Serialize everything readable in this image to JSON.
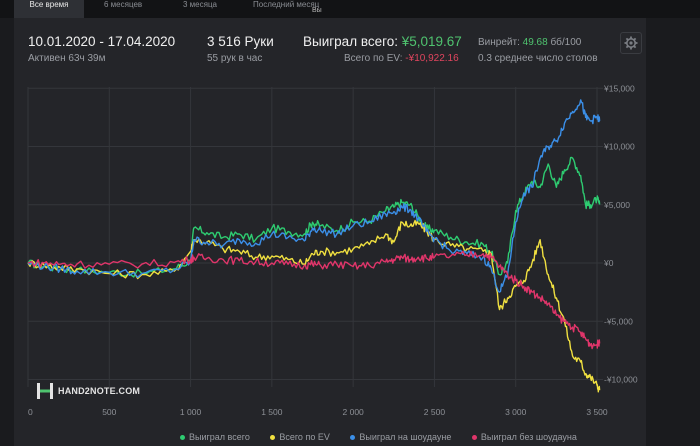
{
  "tabs": [
    {
      "label": "Все время",
      "active": true
    },
    {
      "label": "6 месяцев",
      "active": false
    },
    {
      "label": "3 месяца",
      "active": false
    },
    {
      "label": "Последний месяц",
      "active": false
    }
  ],
  "tab_extra": "Вы",
  "summary": {
    "date_range": "10.01.2020 - 17.04.2020",
    "active_time": "Активен 63ч 39м",
    "hands": "3 516 Руки",
    "hands_per_hour": "55 рук в час",
    "won_total_label": "Выиграл всего:",
    "won_total_value": "¥5,019.67",
    "ev_total_label": "Всего по EV:",
    "ev_total_value": "-¥10,922.16",
    "winrate_label": "Винрейт:",
    "winrate_value": "49.68",
    "winrate_unit": "бб/100",
    "tables_avg": "0.3 среднее число столов"
  },
  "logo_text": "HAND2NOTE.COM",
  "colors": {
    "won": "#2ecc71",
    "ev": "#f0e040",
    "showdown": "#3b8fe8",
    "no_showdown": "#e0356a",
    "accent_green": "#4fc36f",
    "accent_red": "#e0455e"
  },
  "chart_data": {
    "type": "line",
    "x_ticks": [
      "0",
      "500",
      "1 000",
      "1 500",
      "2 000",
      "2 500",
      "3 000",
      "3 500"
    ],
    "y_ticks": [
      "¥15,000",
      "¥10,000",
      "¥5,000",
      "¥0",
      "-¥5,000",
      "-¥10,000"
    ],
    "xlim": [
      0,
      3516
    ],
    "ylim": [
      -11000,
      15000
    ],
    "grid": true,
    "legend_position": "bottom",
    "series": [
      {
        "name": "Выиграл всего",
        "color": "#2ecc71",
        "points": [
          [
            0,
            0
          ],
          [
            100,
            -300
          ],
          [
            200,
            -500
          ],
          [
            300,
            -600
          ],
          [
            500,
            -800
          ],
          [
            700,
            -900
          ],
          [
            900,
            -500
          ],
          [
            1000,
            200
          ],
          [
            1020,
            3000
          ],
          [
            1100,
            2600
          ],
          [
            1200,
            2200
          ],
          [
            1300,
            2500
          ],
          [
            1400,
            2000
          ],
          [
            1500,
            3000
          ],
          [
            1600,
            2700
          ],
          [
            1700,
            2500
          ],
          [
            1750,
            3500
          ],
          [
            1800,
            3200
          ],
          [
            1900,
            2800
          ],
          [
            2000,
            3500
          ],
          [
            2100,
            3600
          ],
          [
            2200,
            4500
          ],
          [
            2250,
            4800
          ],
          [
            2300,
            5200
          ],
          [
            2350,
            5000
          ],
          [
            2400,
            4000
          ],
          [
            2450,
            3000
          ],
          [
            2500,
            2800
          ],
          [
            2600,
            2200
          ],
          [
            2700,
            1800
          ],
          [
            2800,
            1600
          ],
          [
            2850,
            900
          ],
          [
            2900,
            -1000
          ],
          [
            2950,
            0
          ],
          [
            3000,
            4500
          ],
          [
            3050,
            6000
          ],
          [
            3100,
            7000
          ],
          [
            3150,
            6500
          ],
          [
            3200,
            8500
          ],
          [
            3250,
            6500
          ],
          [
            3300,
            8000
          ],
          [
            3350,
            9000
          ],
          [
            3400,
            7500
          ],
          [
            3430,
            5000
          ],
          [
            3460,
            5000
          ],
          [
            3500,
            5500
          ],
          [
            3516,
            5020
          ]
        ]
      },
      {
        "name": "Всего по EV",
        "color": "#f0e040",
        "points": [
          [
            0,
            0
          ],
          [
            100,
            -200
          ],
          [
            200,
            -400
          ],
          [
            300,
            -500
          ],
          [
            500,
            -900
          ],
          [
            700,
            -1000
          ],
          [
            900,
            -700
          ],
          [
            1000,
            1000
          ],
          [
            1020,
            2000
          ],
          [
            1100,
            1800
          ],
          [
            1200,
            1200
          ],
          [
            1300,
            1000
          ],
          [
            1400,
            500
          ],
          [
            1500,
            600
          ],
          [
            1600,
            300
          ],
          [
            1700,
            -100
          ],
          [
            1750,
            800
          ],
          [
            1800,
            1000
          ],
          [
            1900,
            900
          ],
          [
            2000,
            1200
          ],
          [
            2100,
            1600
          ],
          [
            2200,
            2500
          ],
          [
            2250,
            1800
          ],
          [
            2300,
            3500
          ],
          [
            2350,
            3200
          ],
          [
            2400,
            3400
          ],
          [
            2450,
            2800
          ],
          [
            2500,
            2000
          ],
          [
            2600,
            1500
          ],
          [
            2700,
            1200
          ],
          [
            2800,
            1000
          ],
          [
            2850,
            800
          ],
          [
            2900,
            -4000
          ],
          [
            2950,
            -3000
          ],
          [
            3000,
            -2000
          ],
          [
            3050,
            -1500
          ],
          [
            3100,
            0
          ],
          [
            3150,
            2000
          ],
          [
            3200,
            -1000
          ],
          [
            3250,
            -3000
          ],
          [
            3300,
            -5000
          ],
          [
            3350,
            -8000
          ],
          [
            3400,
            -8500
          ],
          [
            3430,
            -9500
          ],
          [
            3460,
            -9800
          ],
          [
            3500,
            -10500
          ],
          [
            3516,
            -10922
          ]
        ]
      },
      {
        "name": "Выиграл на шоудауне",
        "color": "#3b8fe8",
        "points": [
          [
            0,
            0
          ],
          [
            100,
            -300
          ],
          [
            200,
            -500
          ],
          [
            300,
            -700
          ],
          [
            500,
            -800
          ],
          [
            700,
            -900
          ],
          [
            900,
            -600
          ],
          [
            1000,
            100
          ],
          [
            1020,
            2000
          ],
          [
            1100,
            1800
          ],
          [
            1200,
            1500
          ],
          [
            1300,
            2000
          ],
          [
            1400,
            1700
          ],
          [
            1500,
            2500
          ],
          [
            1600,
            2200
          ],
          [
            1700,
            1900
          ],
          [
            1750,
            3000
          ],
          [
            1800,
            2800
          ],
          [
            1900,
            2500
          ],
          [
            2000,
            3200
          ],
          [
            2100,
            3500
          ],
          [
            2200,
            4200
          ],
          [
            2250,
            4400
          ],
          [
            2300,
            4800
          ],
          [
            2350,
            4600
          ],
          [
            2400,
            3800
          ],
          [
            2450,
            2700
          ],
          [
            2500,
            2100
          ],
          [
            2600,
            1000
          ],
          [
            2700,
            800
          ],
          [
            2800,
            500
          ],
          [
            2850,
            -500
          ],
          [
            2900,
            -2500
          ],
          [
            2950,
            -1000
          ],
          [
            3000,
            3500
          ],
          [
            3050,
            6000
          ],
          [
            3100,
            6500
          ],
          [
            3150,
            9000
          ],
          [
            3200,
            10000
          ],
          [
            3250,
            10500
          ],
          [
            3300,
            12000
          ],
          [
            3350,
            13000
          ],
          [
            3400,
            14000
          ],
          [
            3430,
            12500
          ],
          [
            3460,
            12200
          ],
          [
            3500,
            12500
          ],
          [
            3516,
            12200
          ]
        ]
      },
      {
        "name": "Выиграл без шоудауна",
        "color": "#e0356a",
        "points": [
          [
            0,
            0
          ],
          [
            100,
            0
          ],
          [
            200,
            -100
          ],
          [
            300,
            -100
          ],
          [
            500,
            -100
          ],
          [
            700,
            -100
          ],
          [
            900,
            50
          ],
          [
            1000,
            300
          ],
          [
            1020,
            500
          ],
          [
            1100,
            400
          ],
          [
            1200,
            300
          ],
          [
            1300,
            200
          ],
          [
            1400,
            100
          ],
          [
            1500,
            0
          ],
          [
            1600,
            -100
          ],
          [
            1700,
            -200
          ],
          [
            1750,
            -100
          ],
          [
            1800,
            -200
          ],
          [
            1900,
            -100
          ],
          [
            2000,
            -300
          ],
          [
            2100,
            -200
          ],
          [
            2200,
            100
          ],
          [
            2250,
            300
          ],
          [
            2300,
            500
          ],
          [
            2350,
            300
          ],
          [
            2400,
            500
          ],
          [
            2450,
            400
          ],
          [
            2500,
            500
          ],
          [
            2600,
            600
          ],
          [
            2700,
            700
          ],
          [
            2800,
            800
          ],
          [
            2850,
            500
          ],
          [
            2900,
            -300
          ],
          [
            2950,
            -1000
          ],
          [
            3000,
            -1500
          ],
          [
            3050,
            -2000
          ],
          [
            3100,
            -2500
          ],
          [
            3150,
            -3000
          ],
          [
            3200,
            -3500
          ],
          [
            3250,
            -4500
          ],
          [
            3300,
            -5000
          ],
          [
            3350,
            -5500
          ],
          [
            3400,
            -6000
          ],
          [
            3430,
            -6500
          ],
          [
            3460,
            -7000
          ],
          [
            3500,
            -7000
          ],
          [
            3516,
            -6900
          ]
        ]
      }
    ]
  }
}
